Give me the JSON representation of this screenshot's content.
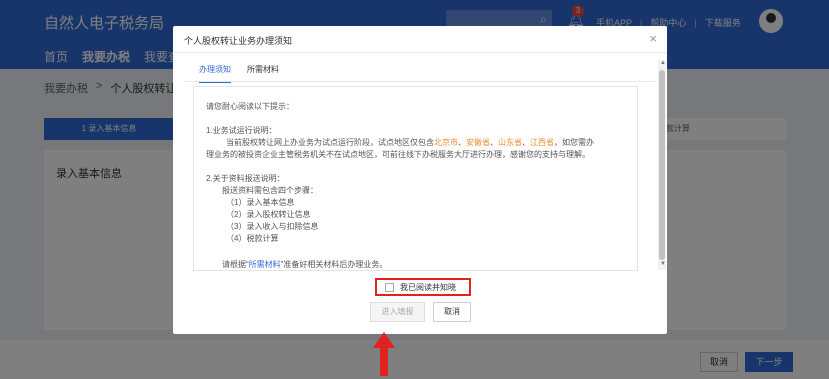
{
  "header": {
    "site_title": "自然人电子税务局",
    "nav": [
      "首页",
      "我要办税",
      "我要查"
    ],
    "badge_count": "3",
    "links": [
      "手机APP",
      "帮助中心",
      "下载服务"
    ]
  },
  "breadcrumb": {
    "root": "我要办税",
    "sep": ">",
    "current": "个人股权转让所"
  },
  "steps": {
    "step1": "1 录入基本信息",
    "step4": "4 税款计算"
  },
  "panel": {
    "title": "录入基本信息"
  },
  "footer": {
    "cancel": "取消",
    "next": "下一步"
  },
  "modal": {
    "title": "个人股权转让业务办理须知",
    "close": "×",
    "tabs": [
      "办理须知",
      "所需材料"
    ],
    "notice": {
      "intro": "请您耐心阅读以下提示：",
      "s1_title": "1.业务试运行说明：",
      "s1_a": "当前股权转让网上办业务为试点运行阶段，试点地区仅包含",
      "cities": [
        "北京市",
        "安徽省",
        "山东省",
        "江西省"
      ],
      "city_sep": "、",
      "s1_b": "，如您需办",
      "s1_c": "理业务的被投资企业主管税务机关不在试点地区，可前往线下办税服务大厅进行办理，感谢您的支持与理解。",
      "s2_title": "2.关于资料报送说明：",
      "s2_a": "报送资料需包含四个步骤：",
      "steps": [
        "（1）录入基本信息",
        "（2）录入股权转让信息",
        "（3）录入收入与扣除信息",
        "（4）税款计算"
      ],
      "s3_a": "请根据“",
      "s3_link": "所需材料",
      "s3_b": "”准备好相关材料后办理业务。"
    },
    "agree_label": "我已阅读并知晓",
    "next_btn": "进入填报",
    "cancel_btn": "取消"
  },
  "colors": {
    "primary": "#2f6ad6",
    "highlight": "#f08b2a",
    "alert": "#e0231f"
  }
}
